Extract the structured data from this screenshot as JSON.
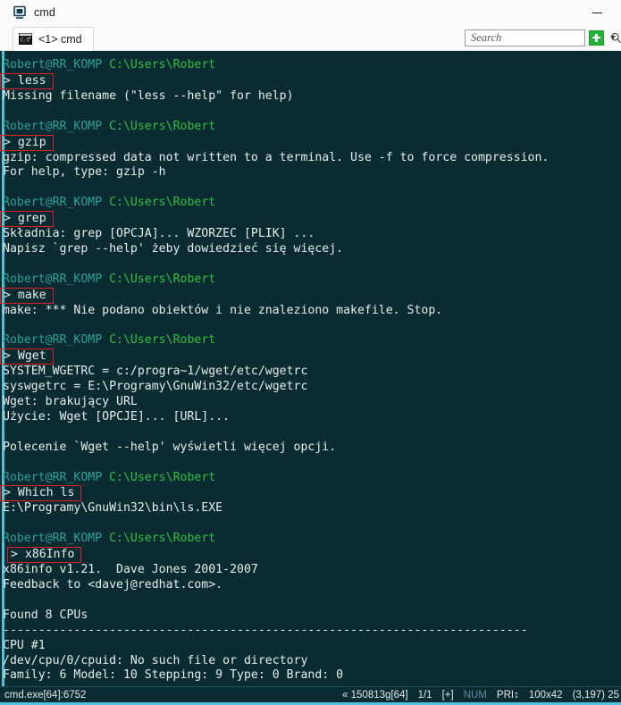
{
  "window": {
    "title": "cmd",
    "app_icon": "console-window-icon",
    "minimize_label": "Minimize"
  },
  "tabbar": {
    "tabs": [
      {
        "label": "<1> cmd",
        "icon": "cmd-console-icon",
        "active": true
      }
    ],
    "search": {
      "placeholder": "Search",
      "value": "",
      "icon": "search-icon"
    },
    "new_tab_button": "new-tab-plus",
    "dropdown_caret": "chevron-down-icon"
  },
  "terminal": {
    "background": "#0b2b33",
    "prompt_host_color": "#2aa198",
    "prompt_path_color": "#2fbf3f",
    "output_color": "#e6ece8",
    "command_box_color": "#e02020",
    "prompt": {
      "host": "Robert@RR_KOMP",
      "path": "C:\\Users\\Robert"
    },
    "blocks": [
      {
        "command": "> less",
        "indent": false,
        "output": [
          "Missing filename (\"less --help\" for help)"
        ]
      },
      {
        "command": "> gzip",
        "indent": false,
        "output": [
          "gzip: compressed data not written to a terminal. Use -f to force compression.",
          "For help, type: gzip -h"
        ]
      },
      {
        "command": "> grep",
        "indent": false,
        "output": [
          "Składnia: grep [OPCJA]... WZORZEC [PLIK] ...",
          "Napisz `grep --help' żeby dowiedzieć się więcej."
        ]
      },
      {
        "command": "> make",
        "indent": false,
        "output": [
          "make: *** Nie podano obiektów i nie znaleziono makefile. Stop."
        ]
      },
      {
        "command": "> Wget",
        "indent": false,
        "output": [
          "SYSTEM_WGETRC = c:/progra~1/wget/etc/wgetrc",
          "syswgetrc = E:\\Programy\\GnuWin32/etc/wgetrc",
          "Wget: brakujący URL",
          "Użycie: Wget [OPCJE]... [URL]...",
          "",
          "Polecenie `Wget --help' wyświetli więcej opcji."
        ]
      },
      {
        "command": "> Which ls",
        "indent": false,
        "output": [
          "E:\\Programy\\GnuWin32\\bin\\ls.EXE"
        ]
      },
      {
        "command": "> x86Info",
        "indent": true,
        "output": [
          "x86info v1.21.  Dave Jones 2001-2007",
          "Feedback to <davej@redhat.com>.",
          "",
          "Found 8 CPUs",
          "--------------------------------------------------------------------------",
          "CPU #1",
          "/dev/cpu/0/cpuid: No such file or directory",
          "Family: 6 Model: 10 Stepping: 9 Type: 0 Brand: 0"
        ]
      }
    ]
  },
  "statusbar": {
    "process": "cmd.exe[64]:6752",
    "build": "« 150813g[64]",
    "pages": "1/1",
    "insert_mode": "[+]",
    "num_lock": "NUM",
    "priority": "PRI↕",
    "console_size": "100x42",
    "cursor_position": "(3,197) 25"
  }
}
